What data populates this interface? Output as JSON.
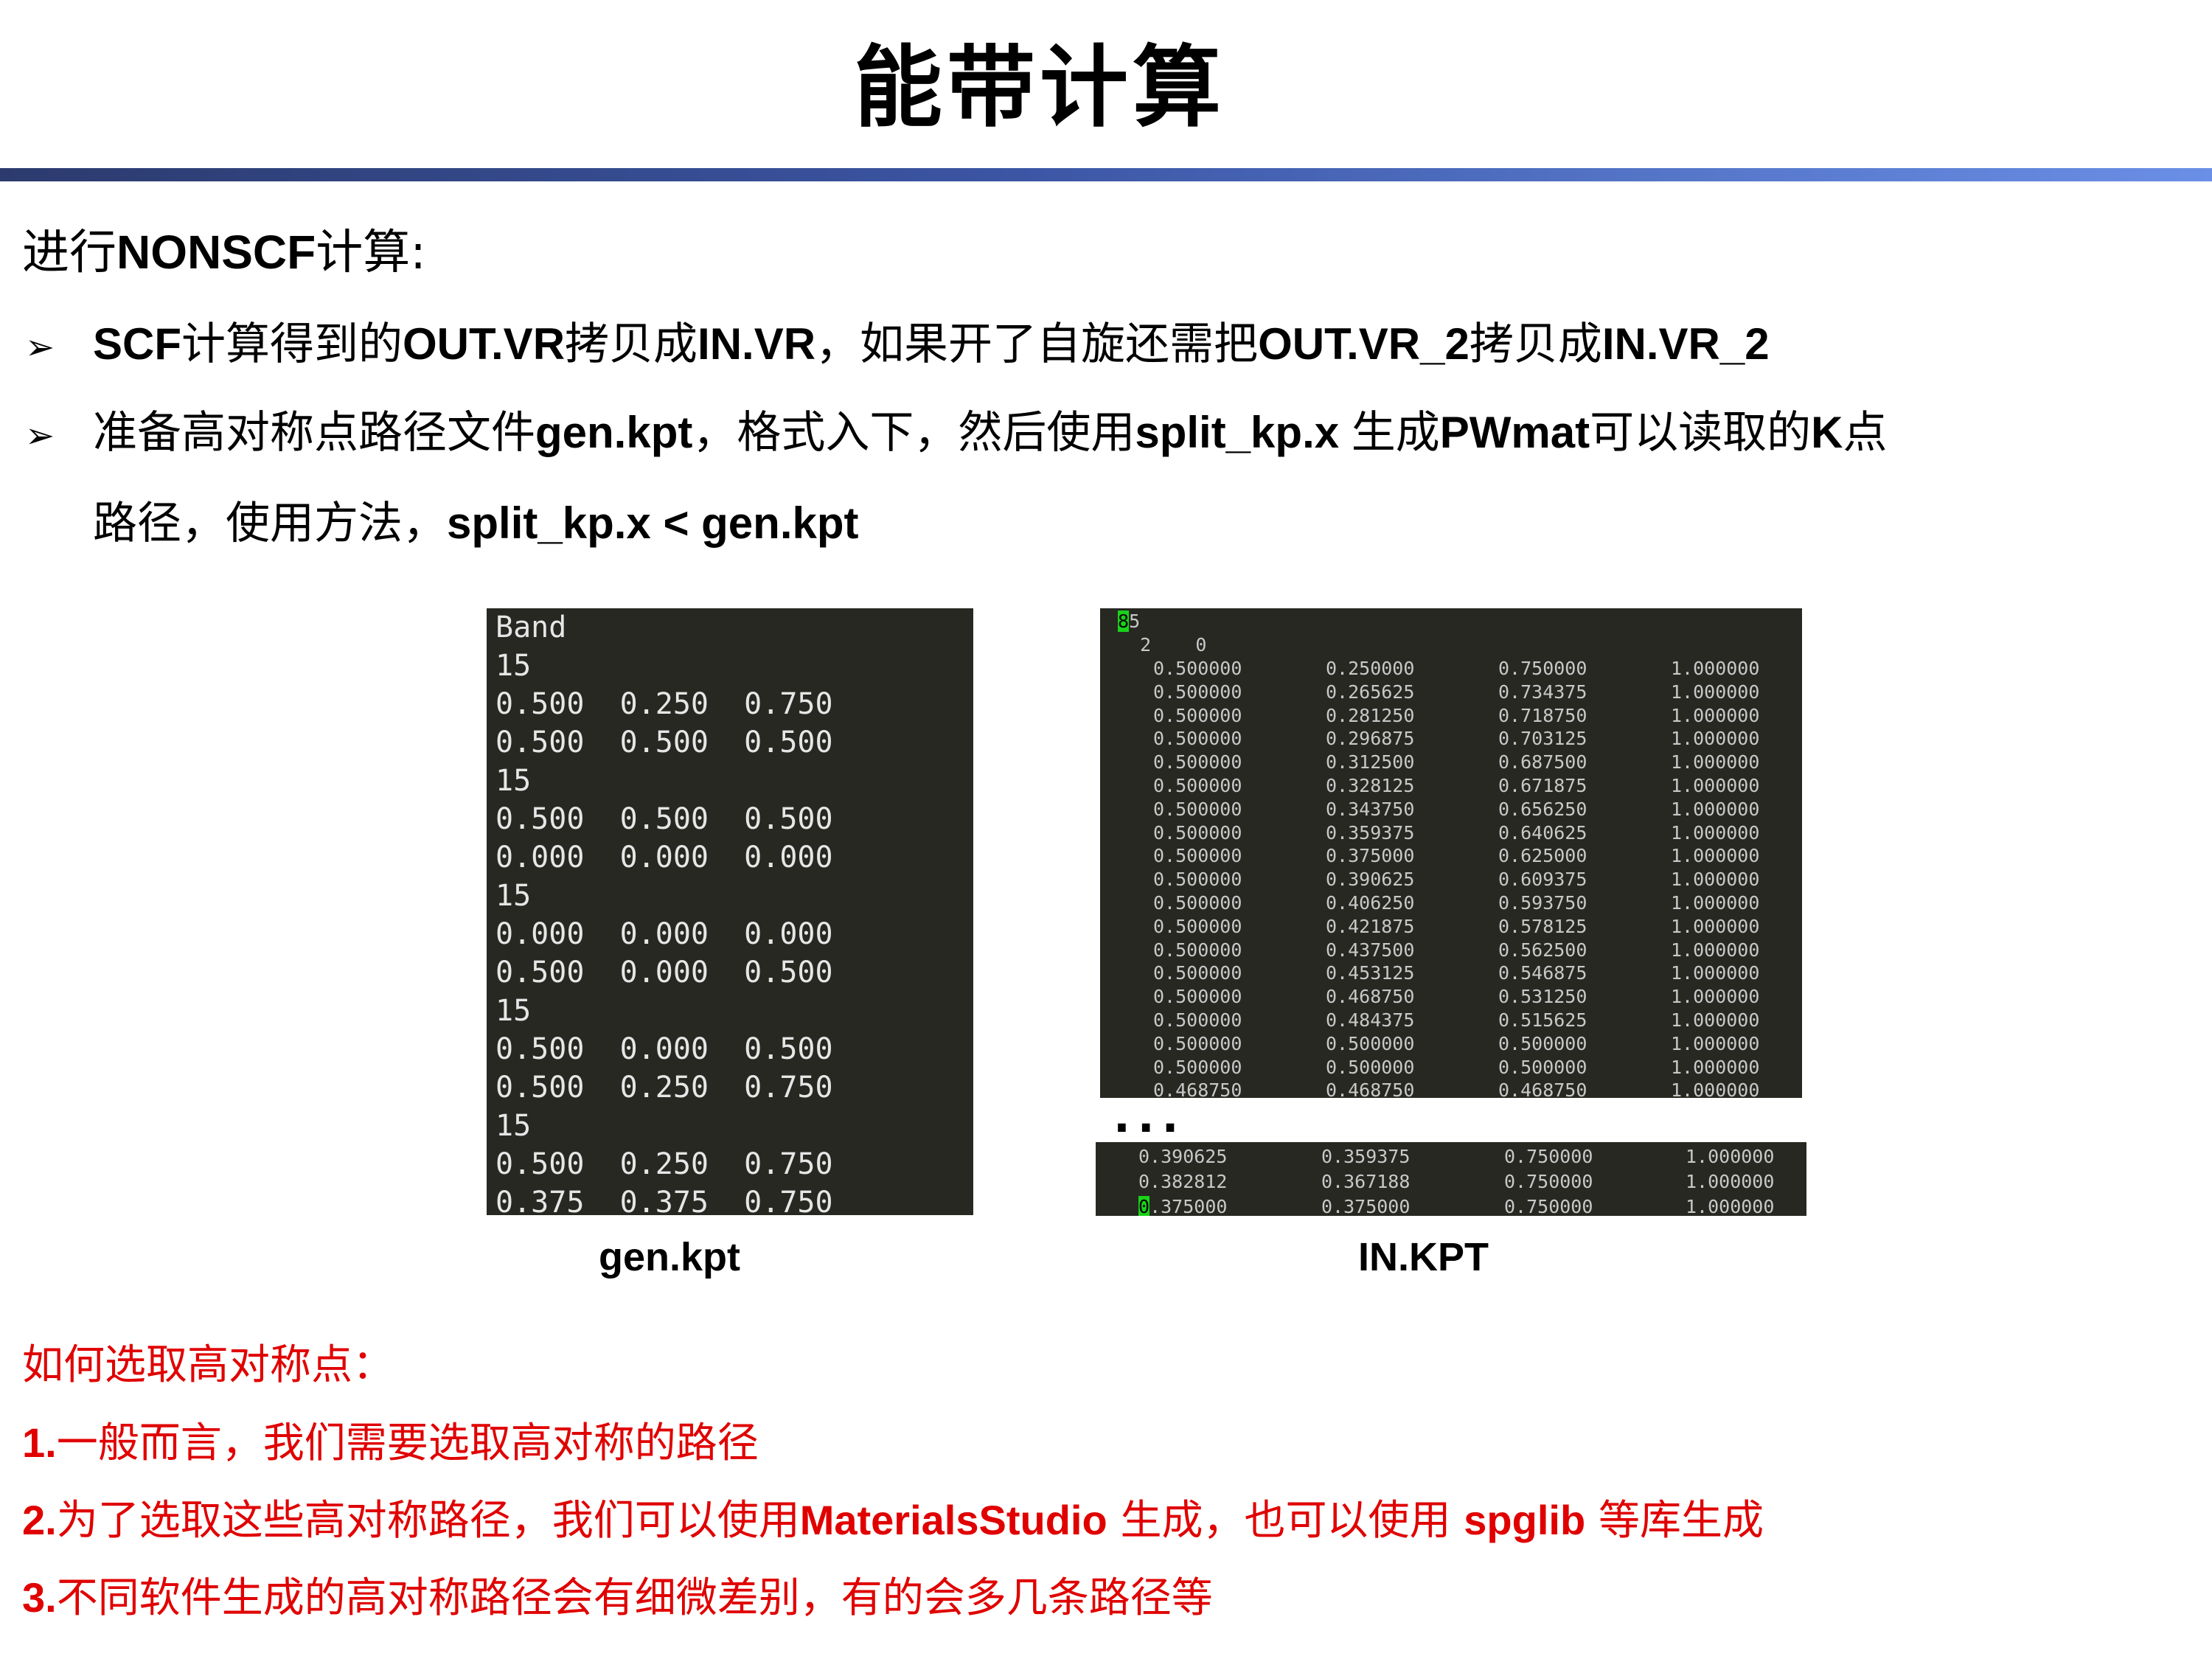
{
  "slide": {
    "title": "能带计算",
    "heading_prefix": "进行",
    "heading_bold": "NONSCF",
    "heading_suffix": "计算:"
  },
  "bullets": [
    {
      "arrow": "➢",
      "parts": [
        "",
        "SCF",
        "计算得到的",
        "OUT.VR",
        "拷贝成",
        "IN.VR",
        "，如果开了自旋还需把",
        "OUT.VR_2",
        "拷贝成",
        "IN.VR_2"
      ]
    },
    {
      "arrow": "➢",
      "parts": [
        "准备高对称点路径文件",
        "gen.kpt",
        "，格式入下，然后使用",
        "split_kp.x ",
        "生成",
        "PWmat",
        "可以读取的",
        "K",
        "点"
      ]
    }
  ],
  "bullet2_cont": [
    "路径，使用方法，",
    "split_kp.x < gen.kpt"
  ],
  "gen_kpt": {
    "caption": "gen.kpt",
    "lines": [
      "Band",
      "15",
      "0.500  0.250  0.750",
      "0.500  0.500  0.500",
      "15",
      "0.500  0.500  0.500",
      "0.000  0.000  0.000",
      "15",
      "0.000  0.000  0.000",
      "0.500  0.000  0.500",
      "15",
      "0.500  0.000  0.500",
      "0.500  0.250  0.750",
      "15",
      "0.500  0.250  0.750",
      "0.375  0.375  0.750"
    ]
  },
  "in_kpt": {
    "caption": "IN.KPT",
    "first_line_cursor": "8",
    "first_line_rest": "5",
    "second_line": "  2    0",
    "rows": [
      [
        "0.500000",
        "0.250000",
        "0.750000",
        "1.000000"
      ],
      [
        "0.500000",
        "0.265625",
        "0.734375",
        "1.000000"
      ],
      [
        "0.500000",
        "0.281250",
        "0.718750",
        "1.000000"
      ],
      [
        "0.500000",
        "0.296875",
        "0.703125",
        "1.000000"
      ],
      [
        "0.500000",
        "0.312500",
        "0.687500",
        "1.000000"
      ],
      [
        "0.500000",
        "0.328125",
        "0.671875",
        "1.000000"
      ],
      [
        "0.500000",
        "0.343750",
        "0.656250",
        "1.000000"
      ],
      [
        "0.500000",
        "0.359375",
        "0.640625",
        "1.000000"
      ],
      [
        "0.500000",
        "0.375000",
        "0.625000",
        "1.000000"
      ],
      [
        "0.500000",
        "0.390625",
        "0.609375",
        "1.000000"
      ],
      [
        "0.500000",
        "0.406250",
        "0.593750",
        "1.000000"
      ],
      [
        "0.500000",
        "0.421875",
        "0.578125",
        "1.000000"
      ],
      [
        "0.500000",
        "0.437500",
        "0.562500",
        "1.000000"
      ],
      [
        "0.500000",
        "0.453125",
        "0.546875",
        "1.000000"
      ],
      [
        "0.500000",
        "0.468750",
        "0.531250",
        "1.000000"
      ],
      [
        "0.500000",
        "0.484375",
        "0.515625",
        "1.000000"
      ],
      [
        "0.500000",
        "0.500000",
        "0.500000",
        "1.000000"
      ],
      [
        "0.500000",
        "0.500000",
        "0.500000",
        "1.000000"
      ],
      [
        "0.468750",
        "0.468750",
        "0.468750",
        "1.000000"
      ]
    ],
    "ellipsis": "...",
    "tail_rows": [
      [
        "0.390625",
        "0.359375",
        "0.750000",
        "1.000000"
      ],
      [
        "0.382812",
        "0.367188",
        "0.750000",
        "1.000000"
      ]
    ],
    "last_row_cursor": "0",
    "last_row": [
      ".375000",
      "0.375000",
      "0.750000",
      "1.000000"
    ]
  },
  "notes": {
    "title": "如何选取高对称点：",
    "items": [
      [
        "1.",
        "一般而言，我们需要选取高对称的路径"
      ],
      [
        "2.",
        "为了选取这些高对称路径，我们可以使用",
        "MaterialsStudio",
        " 生成，也可以使用 ",
        "spglib",
        " 等库生成"
      ],
      [
        "3.",
        "不同软件生成的高对称路径会有细微差别，有的会多几条路径等"
      ]
    ]
  },
  "colors": {
    "note_red": "#e00000",
    "terminal_bg": "#272822",
    "cursor": "#19d219"
  }
}
